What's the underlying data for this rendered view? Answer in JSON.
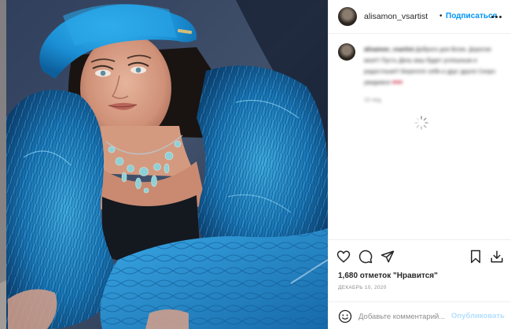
{
  "post": {
    "author": {
      "username": "alisamon_vsartist",
      "separator": "•",
      "follow_label": "Подписаться",
      "more_icon": "more-horizontal-icon"
    },
    "caption": {
      "username": "alisamon_vsartist",
      "text": "Доброго дня Всем. Дорогие мои!!! Пусть День ваш будет успешным и радостным!!! Берегите себя и друг друга! Скоро увидимся",
      "emojis": "♥♥♥",
      "time": "10 нед."
    },
    "loading_icon": "spinner-icon",
    "actions": {
      "like_icon": "heart-icon",
      "comment_icon": "comment-icon",
      "share_icon": "share-icon",
      "save_icon": "bookmark-icon",
      "download_icon": "download-icon"
    },
    "likes_label": "1,680 отметок \"Нравится\"",
    "date_label": "ДЕКАБРЬ 10, 2020",
    "comment_box": {
      "emoji_icon": "smiley-icon",
      "placeholder": "Добавьте комментарий...",
      "publish_label": "Опубликовать"
    }
  },
  "colors": {
    "link_blue": "#0095f6",
    "publish_disabled": "#b2dffc",
    "hat_fur_blue": "#1f7fb8",
    "text_primary": "#262626",
    "text_secondary": "#8e8e8e"
  }
}
